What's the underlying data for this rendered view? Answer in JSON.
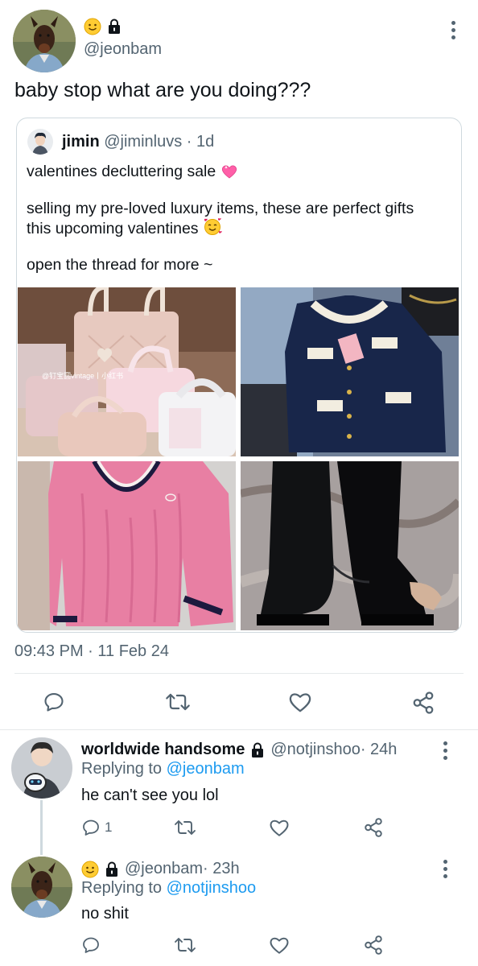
{
  "main_tweet": {
    "handle": "@jeonbam",
    "text": "baby stop what are you doing???",
    "timestamp": "09:43 PM · 11 Feb 24"
  },
  "quoted_tweet": {
    "name": "jimin",
    "handle": "@jiminluvs",
    "time": "· 1d",
    "line1": "valentines decluttering sale",
    "line2": "selling my pre-loved luxury items, these are perfect gifts",
    "line3": "this upcoming valentines",
    "line4": "open the thread for more ~",
    "watermark": "@钉宝圆vintage丨小红书"
  },
  "replies": [
    {
      "name": "worldwide handsome",
      "handle": "@notjinshoo",
      "time": "· 24h",
      "replying_prefix": "Replying to",
      "replying_to": "@jeonbam",
      "text": "he can't see you lol",
      "reply_count": "1"
    },
    {
      "handle": "@jeonbam",
      "time": "· 23h",
      "replying_prefix": "Replying to",
      "replying_to": "@notjinshoo",
      "text": "no shit"
    }
  ],
  "colors": {
    "accent": "#1d9bf0",
    "muted": "#536471",
    "border": "#cfd9de"
  },
  "icons": [
    "reply-icon",
    "retweet-icon",
    "like-icon",
    "share-icon",
    "lock-icon",
    "more-icon"
  ]
}
